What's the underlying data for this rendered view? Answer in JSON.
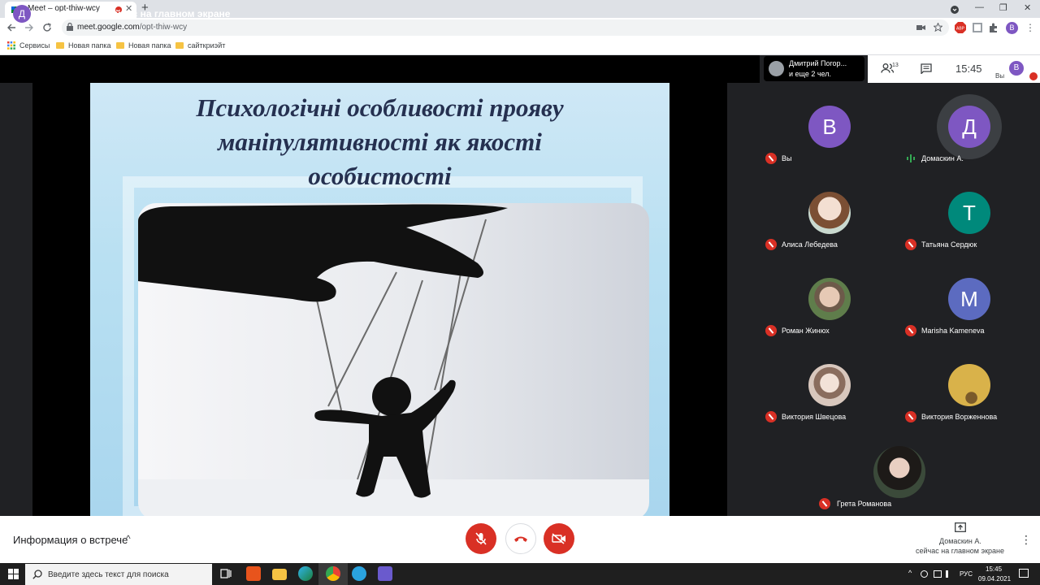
{
  "browser": {
    "tab_title": "Meet – opt-thiw-wcy",
    "tab_close": "✕",
    "new_tab": "+",
    "minimize": "—",
    "restore": "❐",
    "close": "✕",
    "url_host": "meet.google.com",
    "url_path": "/opt-thiw-wcy",
    "profile_initial": "В",
    "bookmarks": [
      "Сервисы",
      "Новая папка",
      "Новая папка",
      "сайткриэйт"
    ]
  },
  "meet": {
    "presenter_initial": "Д",
    "presenter_text": "Домаскин А. сейчас на главном экране",
    "chip_line1": "Дмитрий Погор...",
    "chip_line2": "и еще 2 чел.",
    "people_count": "13",
    "clock": "15:45",
    "you_initial": "В",
    "you_label": "Вы",
    "slide_title_lines": [
      "Психологічні особливості прояву",
      "маніпулятивності як якості",
      "особистості"
    ],
    "participants": [
      {
        "name": "Вы",
        "initial": "В",
        "color": "#7e57c2",
        "muted": true
      },
      {
        "name": "Домаскин А.",
        "initial": "Д",
        "color": "#7e57c2",
        "muted": false
      },
      {
        "name": "Алиса Лебедева",
        "initial": "",
        "color": "#c7a48a",
        "muted": true
      },
      {
        "name": "Татьяна Сердюк",
        "initial": "Т",
        "color": "#00897b",
        "muted": true
      },
      {
        "name": "Роман Жинюх",
        "initial": "",
        "color": "#5f7d4b",
        "muted": true
      },
      {
        "name": "Marisha Kameneva",
        "initial": "M",
        "color": "#5c6bc0",
        "muted": true
      },
      {
        "name": "Виктория Швецова",
        "initial": "",
        "color": "#d8c7bd",
        "muted": true
      },
      {
        "name": "Виктория Ворженнова",
        "initial": "",
        "color": "#d9b24a",
        "muted": true
      },
      {
        "name": "Грета Романова",
        "initial": "",
        "color": "#3b4a3a",
        "muted": true
      }
    ],
    "meeting_info": "Информация о встрече",
    "info_caret": "^",
    "presenting_line1": "Домаскин А.",
    "presenting_line2": "сейчас на главном экране",
    "more": "⋮"
  },
  "taskbar": {
    "search_placeholder": "Введите здесь текст для поиска",
    "lang": "РУС",
    "time": "15:45",
    "date": "09.04.2021"
  },
  "colors": {
    "danger": "#d93025",
    "avatar_purple": "#7e57c2"
  }
}
